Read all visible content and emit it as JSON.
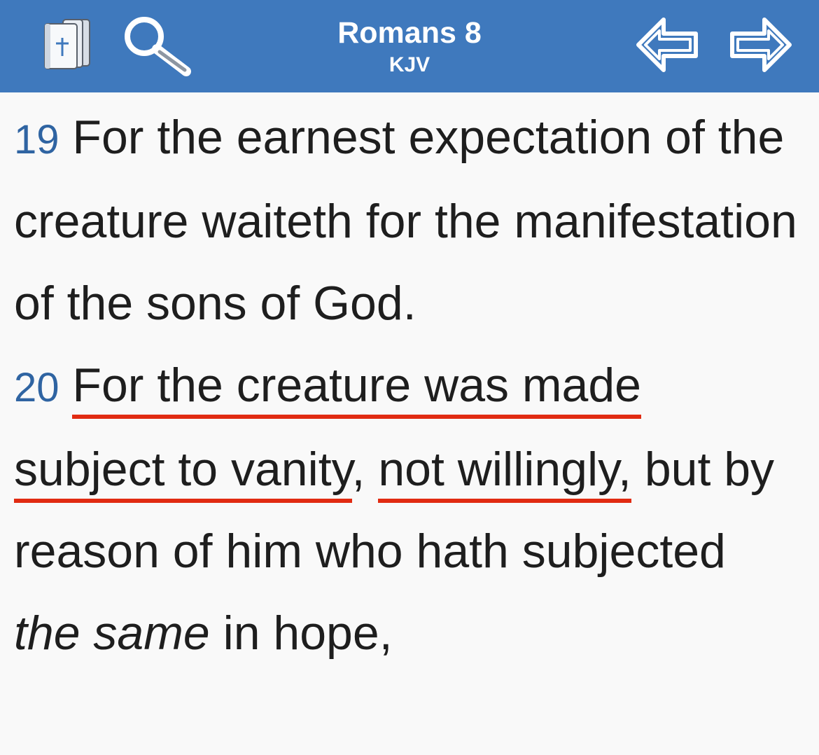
{
  "header": {
    "title": "Romans 8",
    "subtitle": "KJV",
    "icons": {
      "library": "bible-library-icon",
      "search": "magnifier-search-icon",
      "previous": "left-arrow-icon",
      "next": "right-arrow-icon"
    }
  },
  "colors": {
    "header_bg": "#3f79bd",
    "verse_number": "#2f64a2",
    "text": "#1e1e1e",
    "underline": "#e12b12",
    "page_bg": "#f9f9f9"
  },
  "verses": [
    {
      "number": "19",
      "text": "For the earnest expectation of the creature waiteth for the manifestation of the sons of God."
    },
    {
      "number": "20",
      "underline_1": "For the creature was made subject to vanity",
      "comma": ",",
      "space": " ",
      "underline_2": "not willingly,",
      "middle": " but by reason of him who hath subjected ",
      "italic": "the same",
      "end": " in hope,"
    }
  ]
}
